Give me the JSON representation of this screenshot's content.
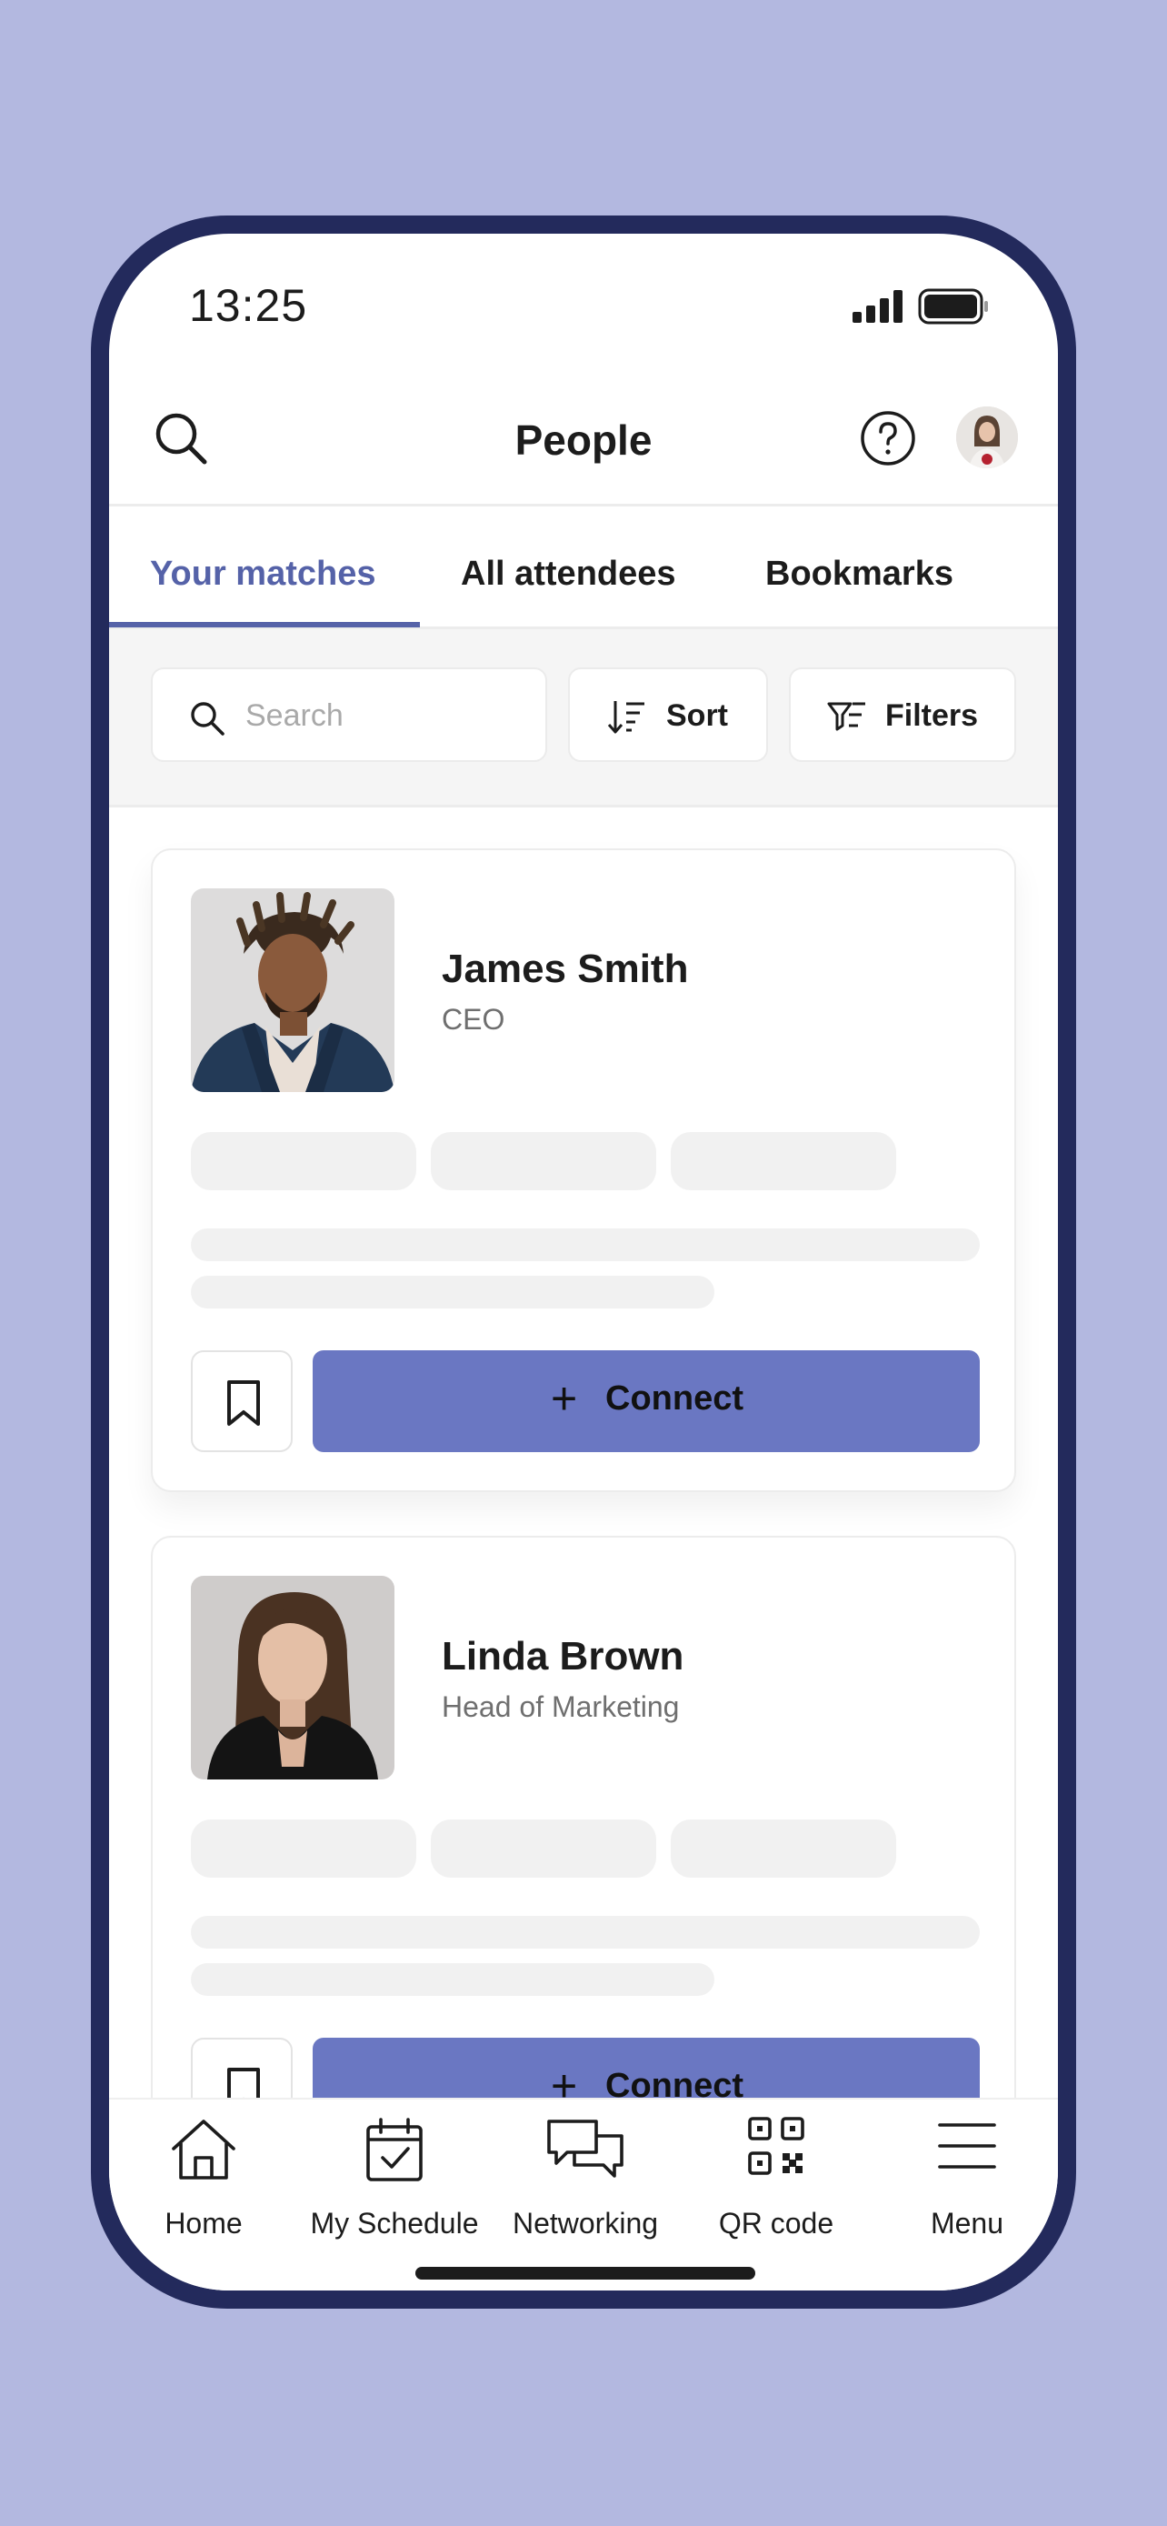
{
  "status_bar": {
    "time": "13:25"
  },
  "header": {
    "title": "People"
  },
  "tabs": [
    {
      "label": "Your matches",
      "active": true
    },
    {
      "label": "All attendees",
      "active": false
    },
    {
      "label": "Bookmarks",
      "active": false
    }
  ],
  "toolbar": {
    "search_placeholder": "Search",
    "sort_label": "Sort",
    "filters_label": "Filters"
  },
  "people": [
    {
      "name": "James Smith",
      "role": "CEO",
      "connect_label": "Connect"
    },
    {
      "name": "Linda Brown",
      "role": "Head of Marketing",
      "connect_label": "Connect"
    }
  ],
  "bottom_nav": [
    {
      "label": "Home",
      "icon": "home-icon"
    },
    {
      "label": "My Schedule",
      "icon": "calendar-check-icon"
    },
    {
      "label": "Networking",
      "icon": "chat-bubbles-icon"
    },
    {
      "label": "QR code",
      "icon": "qr-code-icon"
    },
    {
      "label": "Menu",
      "icon": "hamburger-menu-icon"
    }
  ],
  "colors": {
    "background": "#b3b8e0",
    "phone_frame": "#232a5c",
    "accent": "#5562a8",
    "connect_button": "#6a77c2"
  }
}
